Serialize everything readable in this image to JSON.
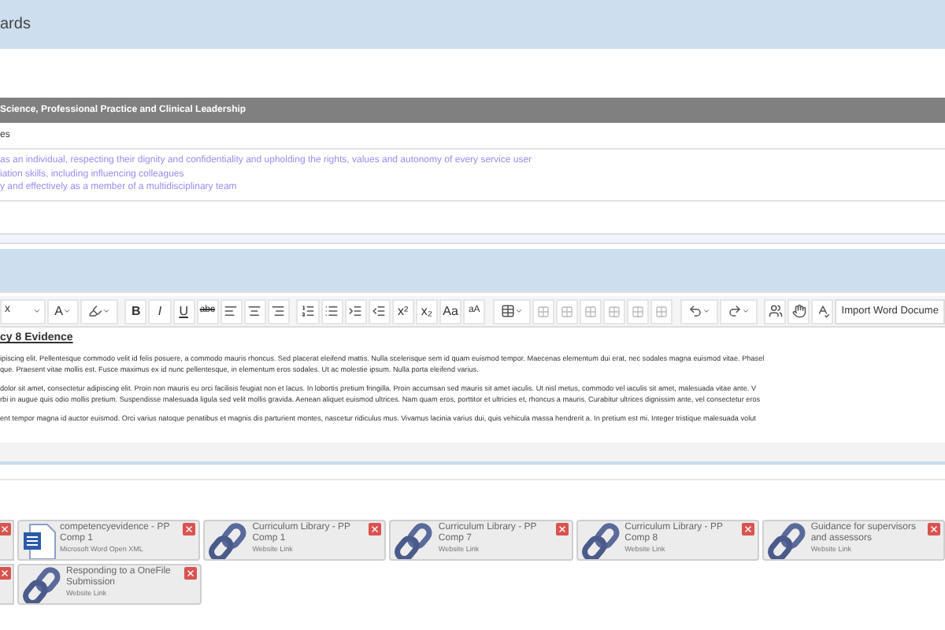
{
  "page_title": "ards",
  "section": {
    "title": "Science, Professional Practice and Clinical Leadership",
    "subtitle": "es",
    "items": [
      "as an individual, respecting their dignity and confidentiality and upholding the rights, values and autonomy of every service user",
      "iation skills, including influencing colleagues",
      "y and effectively as a member of a multidisciplinary team"
    ]
  },
  "toolbar": {
    "font": "x",
    "font_color_label": "A",
    "bold": "B",
    "italic": "I",
    "underline": "U",
    "strike": "abc",
    "superscript": "x²",
    "subscript": "x₂",
    "case_upper": "Aa",
    "case_lower": "aA",
    "import_button": "Import Word Docume"
  },
  "editor": {
    "heading": "cy 8 Evidence",
    "paragraphs": [
      [
        "ipiscing elit. Pellentesque commodo velit id felis posuere, a commodo mauris rhoncus. Sed placerat eleifend mattis. Nulla scelerisque sem id quam euismod tempor. Maecenas elementum dui erat, nec sodales magna euismod vitae. Phasel",
        "que. Praesent vitae mollis est. Fusce maximus ex id nunc pellentesque, in elementum eros sodales. Ut ac molestie ipsum. Nulla porta eleifend varius."
      ],
      [
        "dolor sit amet, consectetur adipiscing elit. Proin non mauris eu orci facilisis feugiat non et lacus. In lobortis pretium fringilla. Proin accumsan sed mauris sit amet iaculis. Ut nisl metus, commodo vel iaculis sit amet, malesuada vitae ante. V",
        "rbi in augue quis odio mollis pretium. Suspendisse malesuada ligula sed velit mollis gravida. Aenean aliquet euismod ultrices. Nam quam eros, porttitor et ultricies et, rhoncus a mauris. Curabitur ultrices dignissim ante, vel consectetur eros"
      ],
      [
        "ent tempor magna id auctor euismod. Orci varius natoque penatibus et magnis dis parturient montes, nascetur ridiculus mus. Vivamus lacinia varius dui, quis vehicula massa hendrerit a. In pretium est mi. Integer tristique malesuada volut"
      ]
    ]
  },
  "attachment_rows": [
    [
      {
        "kind": "word",
        "title": "competencyevidence - PP Comp 1",
        "type": "Microsoft Word Open XML"
      },
      {
        "kind": "link",
        "title": "Curriculum Library - PP Comp 1",
        "type": "Website Link"
      },
      {
        "kind": "link",
        "title": "Curriculum Library - PP Comp 7",
        "type": "Website Link"
      },
      {
        "kind": "link",
        "title": "Curriculum Library - PP Comp 8",
        "type": "Website Link"
      },
      {
        "kind": "link",
        "title": "Guidance for supervisors and assessors",
        "type": "Website Link"
      }
    ],
    [
      {
        "kind": "link",
        "title": "Responding to a OneFile Submission",
        "type": "Website Link"
      }
    ]
  ]
}
